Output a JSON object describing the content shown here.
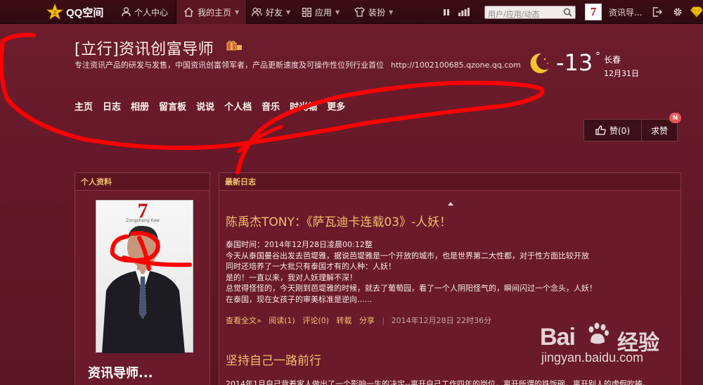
{
  "topbar": {
    "brand": "QQ空间",
    "nav": [
      {
        "label": "个人中心",
        "icon": "user-icon",
        "caret": false
      },
      {
        "label": "我的主页",
        "icon": "home-icon",
        "caret": true
      },
      {
        "label": "好友",
        "icon": "friends-icon",
        "caret": true
      },
      {
        "label": "应用",
        "icon": "apps-icon",
        "caret": true
      },
      {
        "label": "装扮",
        "icon": "shirt-icon",
        "caret": true
      }
    ],
    "search_placeholder": "用户/应用/动态",
    "avatar_glyph": "7",
    "user_name": "资讯导..."
  },
  "header": {
    "title": "[立行]资讯创富导师",
    "description": "专注资讯产品的研发与发售，中国资讯创富领军者，产品更新速度及可操作性位列行业首位",
    "url": "http://1002100685.qzone.qq.com",
    "weather": {
      "temperature": "-13",
      "degree": "°",
      "city": "长春",
      "date": "12月31日"
    },
    "subnav": [
      "主页",
      "日志",
      "相册",
      "留言板",
      "说说",
      "个人档",
      "音乐",
      "时光轴",
      "更多"
    ]
  },
  "like": {
    "label": "赞(0)",
    "ask_label": "求赞",
    "badge": "N"
  },
  "profile": {
    "heading": "个人资料",
    "photo_caption": "Zongshang Kaw",
    "name": "资讯导师..."
  },
  "blog": {
    "heading": "最新日志",
    "posts": [
      {
        "title": "陈禹杰TONY：《萨瓦迪卡连载03》-人妖！",
        "lines": [
          "泰国时间：2014年12月28日凌晨00:12整",
          "今天从泰国曼谷出发去芭堤雅，据说芭堤雅是一个开放的城市，也是世界第二大性都，对于性方面比较开放",
          "同时还培养了一大批只有泰国才有的人种：人妖！",
          "是的！一直以来，我对人妖理解不深！",
          "总觉得怪怪的，今天刚到芭堤雅的时候，就去了葡萄园，看了一个人阴阳怪气的，瞬间闪过一个念头，人妖！",
          "在泰国，现在女孩子的审美标准是逆向......"
        ],
        "actions": {
          "read_more": "查看全文»",
          "reads": "阅读(1)",
          "comments": "评论(0)",
          "repost": "转载",
          "share": "分享",
          "separator": "|",
          "date": "2014年12月28日 22时36分"
        }
      },
      {
        "title": "坚持自己一路前行",
        "preview": "2014年1月自己背着家人做出了一个影响一生的决定--离开自己工作四年的岗位，离开所谓的铁饭碗，离开别人的虚假吹捧。"
      }
    ]
  },
  "watermark": {
    "brand": "Bai",
    "brand_end": "经验",
    "url": "jingyan.baidu.com"
  },
  "colors": {
    "accent": "#f3bf6b",
    "background": "#6a1a2a",
    "topbar": "#2e0a10",
    "scribble": "#ff0000",
    "badge": "#e95856"
  }
}
